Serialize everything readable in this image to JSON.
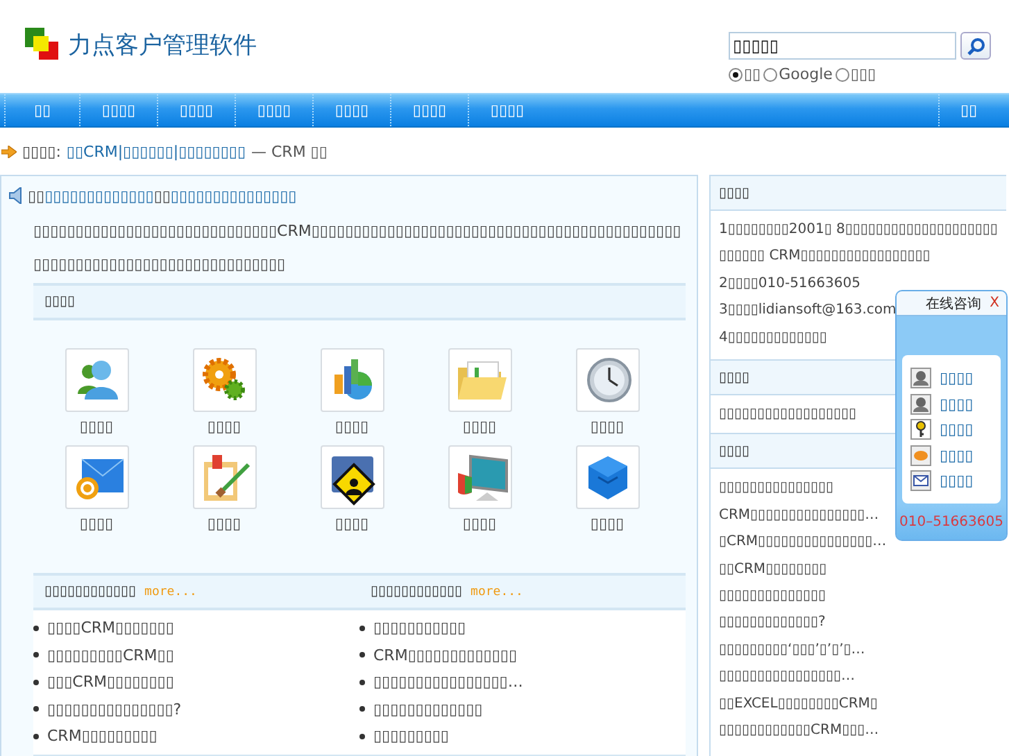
{
  "header": {
    "title": "力点客户管理软件",
    "search": {
      "value": "▯▯▯▯▯"
    },
    "engines": [
      {
        "label": "▯▯",
        "selected": true
      },
      {
        "label": "Google",
        "selected": false
      },
      {
        "label": "▯▯▯",
        "selected": false
      }
    ]
  },
  "nav": {
    "items": [
      "▯▯",
      "▯▯▯▯",
      "▯▯▯▯",
      "▯▯▯▯",
      "▯▯▯▯",
      "▯▯▯▯",
      "▯▯▯▯"
    ],
    "right": "▯▯"
  },
  "breadcrumb": {
    "label": "▯▯▯▯:",
    "link": "▯▯CRM|▯▯▯▯▯▯|▯▯▯▯▯▯▯▯",
    "suffix": "— CRM ▯▯"
  },
  "notice": {
    "parts": [
      {
        "text": "▯▯",
        "link": false
      },
      {
        "text": "▯▯▯▯▯▯▯▯▯▯▯▯▯",
        "link": true
      },
      {
        "text": "▯▯",
        "link": false
      },
      {
        "text": "▯▯▯▯▯▯▯▯▯▯▯▯▯▯▯",
        "link": true
      }
    ]
  },
  "intro": "▯▯▯▯▯▯▯▯▯▯▯▯▯▯▯▯▯▯▯▯▯▯▯▯▯▯▯▯▯CRM▯▯▯▯▯▯▯▯▯▯▯▯▯▯▯▯▯▯▯▯▯▯▯▯▯▯▯▯▯▯▯▯▯▯▯▯▯▯▯▯▯▯▯▯▯▯▯▯▯▯▯▯▯▯▯▯▯▯▯▯▯▯▯▯▯▯▯▯▯▯▯▯▯▯",
  "features": {
    "title": "▯▯▯▯",
    "items": [
      "▯▯▯▯",
      "▯▯▯▯",
      "▯▯▯▯",
      "▯▯▯▯",
      "▯▯▯▯",
      "▯▯▯▯",
      "▯▯▯▯",
      "▯▯▯▯",
      "▯▯▯▯",
      "▯▯▯▯"
    ]
  },
  "news": [
    {
      "title": "▯▯▯▯▯▯▯▯▯▯▯▯",
      "more": "more...",
      "items": [
        "▯▯▯▯CRM▯▯▯▯▯▯▯",
        "▯▯▯▯▯▯▯▯▯CRM▯▯",
        "▯▯▯CRM▯▯▯▯▯▯▯▯",
        "▯▯▯▯▯▯▯▯▯▯▯▯▯▯▯?",
        "CRM▯▯▯▯▯▯▯▯▯"
      ]
    },
    {
      "title": "▯▯▯▯▯▯▯▯▯▯▯▯",
      "more": "more...",
      "items": [
        "▯▯▯▯▯▯▯▯▯▯▯",
        "CRM▯▯▯▯▯▯▯▯▯▯▯▯▯",
        "▯▯▯▯▯▯▯▯▯▯▯▯▯▯▯▯…",
        "▯▯▯▯▯▯▯▯▯▯▯▯▯",
        "▯▯▯▯▯▯▯▯▯"
      ]
    }
  ],
  "sidebar": [
    {
      "title": "▯▯▯▯",
      "lines": [
        "1▯▯▯▯▯▯▯▯2001▯ 8▯▯▯▯▯▯▯▯▯▯▯▯▯▯▯▯▯▯▯▯▯▯▯▯▯▯ CRM▯▯▯▯▯▯▯▯▯▯▯▯▯▯▯▯▯",
        "2▯▯▯▯010-51663605",
        "3▯▯▯▯lidiansoft@163.com",
        "4▯▯▯▯▯▯▯▯▯▯▯▯▯"
      ]
    },
    {
      "title": "▯▯▯▯",
      "lines": [
        "▯▯▯▯▯▯▯▯▯▯▯▯▯▯▯▯▯▯"
      ]
    },
    {
      "title": "▯▯▯▯",
      "lines": [
        "▯▯▯▯▯▯▯▯▯▯▯▯▯▯▯",
        "CRM▯▯▯▯▯▯▯▯▯▯▯▯▯▯▯…",
        "▯CRM▯▯▯▯▯▯▯▯▯▯▯▯▯▯▯…",
        "▯▯CRM▯▯▯▯▯▯▯▯",
        "▯▯▯▯▯▯▯▯▯▯▯▯▯▯",
        "▯▯▯▯▯▯▯▯▯▯▯▯▯?",
        "▯▯▯▯▯▯▯▯▯‘▯▯▯’▯’▯’▯…",
        "▯▯▯▯▯▯▯▯▯▯▯▯▯▯▯▯…",
        "▯▯EXCEL▯▯▯▯▯▯▯▯CRM▯",
        "▯▯▯▯▯▯▯▯▯▯▯▯CRM▯▯▯…"
      ]
    }
  ],
  "popup": {
    "title": "在线咨询",
    "close": "X",
    "items": [
      "▯▯▯▯",
      "▯▯▯▯",
      "▯▯▯▯",
      "▯▯▯▯",
      "▯▯▯▯"
    ],
    "phone": "010–51663605"
  }
}
